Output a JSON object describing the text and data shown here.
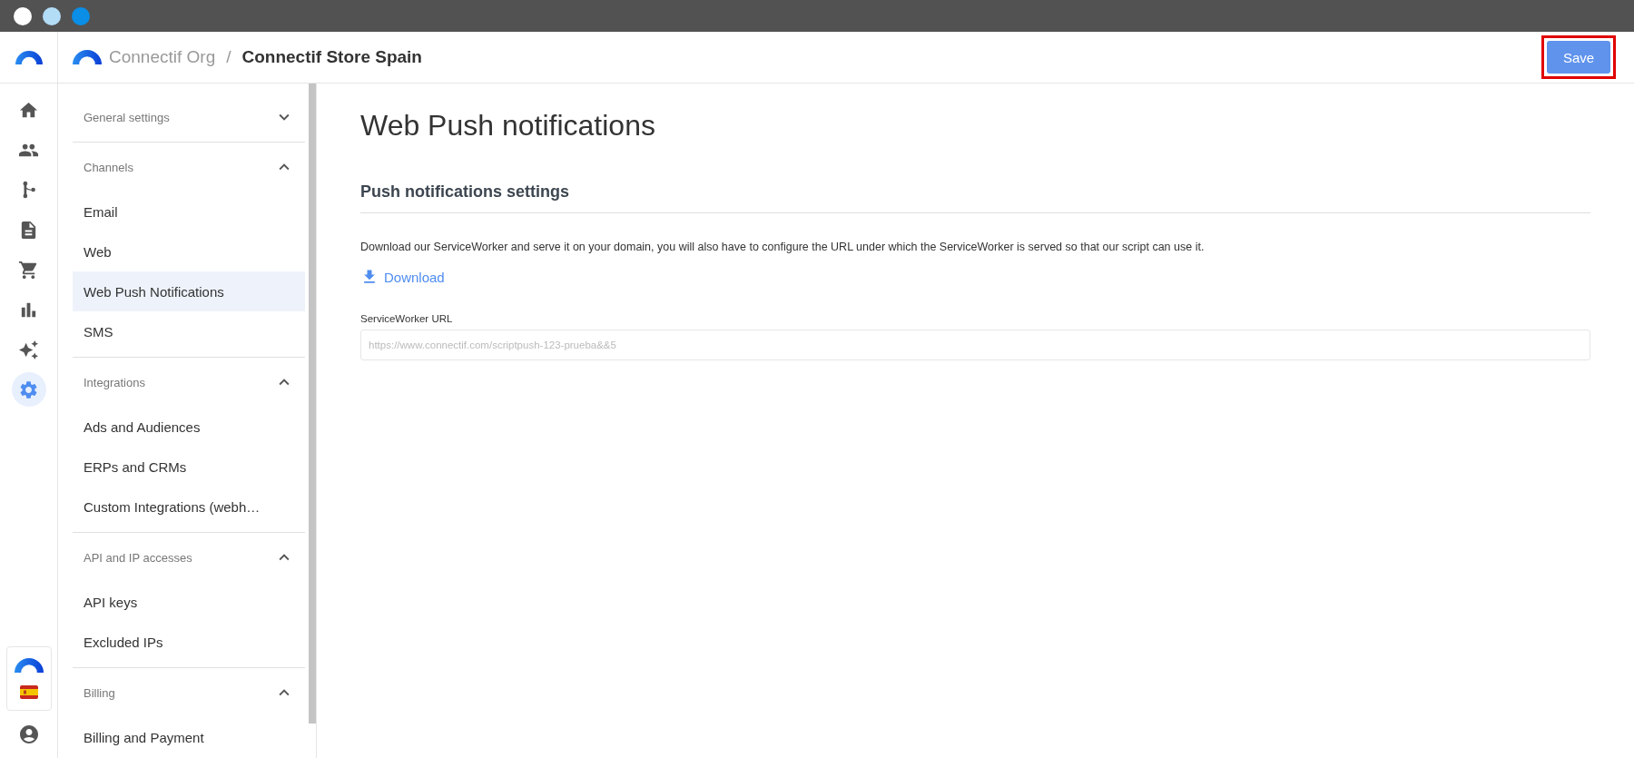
{
  "window": {
    "traffic_lights": [
      {
        "color": "#ffffff"
      },
      {
        "color": "#b3dcf7"
      },
      {
        "color": "#0a8ee6"
      }
    ]
  },
  "rail": {
    "items": [
      {
        "kind": "home",
        "selected": false
      },
      {
        "kind": "people",
        "selected": false
      },
      {
        "kind": "branch",
        "selected": false
      },
      {
        "kind": "document",
        "selected": false
      },
      {
        "kind": "cart",
        "selected": false
      },
      {
        "kind": "chart",
        "selected": false
      },
      {
        "kind": "sparkle",
        "selected": false
      },
      {
        "kind": "settings",
        "selected": true
      }
    ]
  },
  "breadcrumb": {
    "org": "Connectif Org",
    "separator": "/",
    "store": "Connectif Store Spain"
  },
  "save_button": {
    "label": "Save",
    "highlighted": true
  },
  "sidebar": {
    "groups": [
      {
        "title": "General settings",
        "expanded": false
      },
      {
        "title": "Channels",
        "expanded": true,
        "items": [
          {
            "label": "Email",
            "selected": false
          },
          {
            "label": "Web",
            "selected": false
          },
          {
            "label": "Web Push Notifications",
            "selected": true
          },
          {
            "label": "SMS",
            "selected": false
          }
        ]
      },
      {
        "title": "Integrations",
        "expanded": true,
        "items": [
          {
            "label": "Ads and Audiences",
            "selected": false
          },
          {
            "label": "ERPs and CRMs",
            "selected": false
          },
          {
            "label": "Custom Integrations (webh…",
            "selected": false
          }
        ]
      },
      {
        "title": "API and IP accesses",
        "expanded": true,
        "items": [
          {
            "label": "API keys",
            "selected": false
          },
          {
            "label": "Excluded IPs",
            "selected": false
          }
        ]
      },
      {
        "title": "Billing",
        "expanded": true,
        "items": [
          {
            "label": "Billing and Payment",
            "selected": false
          }
        ]
      }
    ]
  },
  "main": {
    "title": "Web Push notifications",
    "section_title": "Push notifications settings",
    "description": "Download our ServiceWorker and serve it on your domain, you will also have to configure the URL under which the ServiceWorker is served so that our script can use it.",
    "download_link": "Download",
    "field": {
      "label": "ServiceWorker URL",
      "value": "https://www.connectif.com/scriptpush-123-prueba&&5"
    }
  }
}
